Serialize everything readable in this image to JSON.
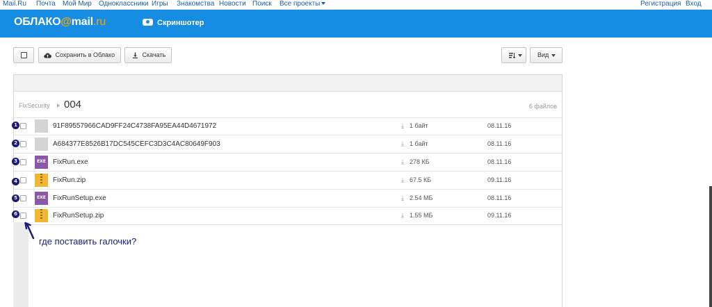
{
  "portal": {
    "links": [
      "Mail.Ru",
      "Почта",
      "Мой Мир",
      "Одноклассники",
      "Игры",
      "Знакомства",
      "Новости",
      "Поиск",
      "Все проекты"
    ],
    "register": "Регистрация",
    "login": "Вход"
  },
  "header": {
    "logo_main": "ОБЛАКО",
    "logo_at": "@",
    "logo_mail": "mail",
    "logo_ru": ".ru",
    "screenshoter": "Скриншотер"
  },
  "toolbar": {
    "save_label": "Сохранить в Облако",
    "download_label": "Скачать",
    "view_label": "Вид"
  },
  "breadcrumb": {
    "root": "FixSecurity",
    "current": "004",
    "count": "6 файлов"
  },
  "files": [
    {
      "badge": "1",
      "name": "91F89557966CAD9FF24C4738FA95EA44D4671972",
      "size": "1 байт",
      "date": "08.11.16",
      "icon": "blank-file-icon"
    },
    {
      "badge": "2",
      "name": "A684377E8526B17DC545CEFC3D3C4AC80649F903",
      "size": "1 байт",
      "date": "08.11.16",
      "icon": "blank-file-icon"
    },
    {
      "badge": "3",
      "name": "FixRun.exe",
      "size": "278 КБ",
      "date": "08.11.16",
      "icon": "exe-file-icon"
    },
    {
      "badge": "4",
      "name": "FixRun.zip",
      "size": "67.5 КБ",
      "date": "09.11.16",
      "icon": "zip-file-icon"
    },
    {
      "badge": "5",
      "name": "FixRunSetup.exe",
      "size": "2.54 МБ",
      "date": "08.11.16",
      "icon": "exe-file-icon"
    },
    {
      "badge": "6",
      "name": "FixRunSetup.zip",
      "size": "1.55 МБ",
      "date": "09.11.16",
      "icon": "zip-file-icon"
    }
  ],
  "annotation": {
    "note": "где поставить галочки?"
  },
  "colors": {
    "header_bg": "#168de2",
    "logo_accent": "#f7a600",
    "annotation": "#1d1b7a",
    "link": "#1a5fb0"
  }
}
